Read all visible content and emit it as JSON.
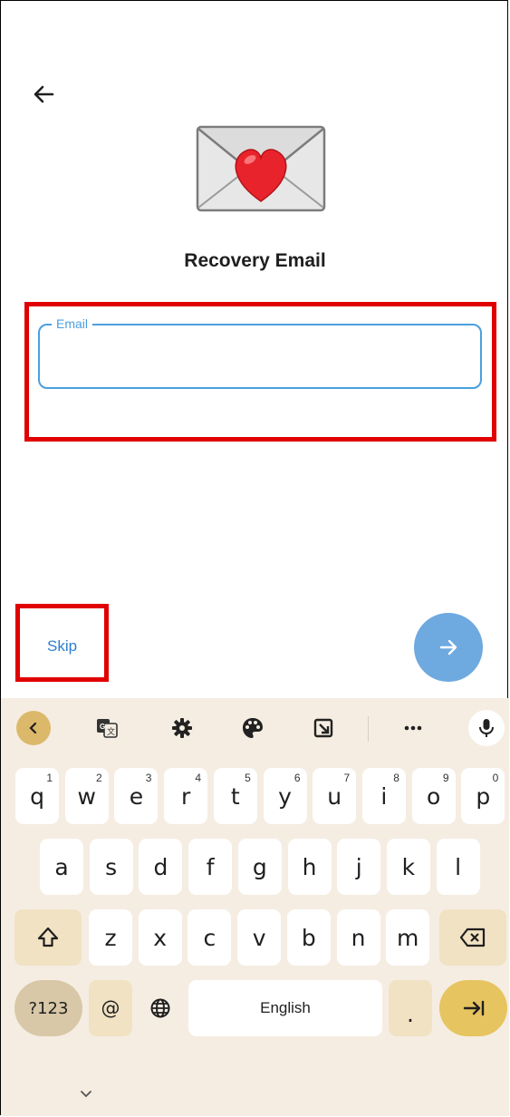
{
  "header": {
    "back_icon": "arrow-left-icon",
    "hero_icon": "envelope-heart-icon",
    "title": "Recovery Email"
  },
  "form": {
    "email_label": "Email",
    "email_value": "",
    "email_placeholder": ""
  },
  "actions": {
    "skip_label": "Skip",
    "next_icon": "arrow-right-icon"
  },
  "colors": {
    "accent": "#4a9fe0",
    "fab": "#6ea9df",
    "highlight": "#e00000",
    "keyboard_bg": "#f5ede2",
    "mod_key": "#f1e2c3",
    "enter_key": "#e6c45f"
  },
  "keyboard": {
    "toolbar": [
      "chevron-left-icon",
      "translate-icon",
      "gear-icon",
      "palette-icon",
      "resize-icon",
      "more-icon",
      "mic-icon"
    ],
    "row1": [
      {
        "k": "q",
        "s": "1"
      },
      {
        "k": "w",
        "s": "2"
      },
      {
        "k": "e",
        "s": "3"
      },
      {
        "k": "r",
        "s": "4"
      },
      {
        "k": "t",
        "s": "5"
      },
      {
        "k": "y",
        "s": "6"
      },
      {
        "k": "u",
        "s": "7"
      },
      {
        "k": "i",
        "s": "8"
      },
      {
        "k": "o",
        "s": "9"
      },
      {
        "k": "p",
        "s": "0"
      }
    ],
    "row2": [
      "a",
      "s",
      "d",
      "f",
      "g",
      "h",
      "j",
      "k",
      "l"
    ],
    "row3": [
      "z",
      "x",
      "c",
      "v",
      "b",
      "n",
      "m"
    ],
    "symbols_label": "?123",
    "at_label": "@",
    "space_label": "English",
    "period_label": ".",
    "shift_icon": "shift-icon",
    "backspace_icon": "backspace-icon",
    "globe_icon": "globe-icon",
    "enter_icon": "tab-arrow-icon",
    "hide_icon": "chevron-down-icon"
  }
}
